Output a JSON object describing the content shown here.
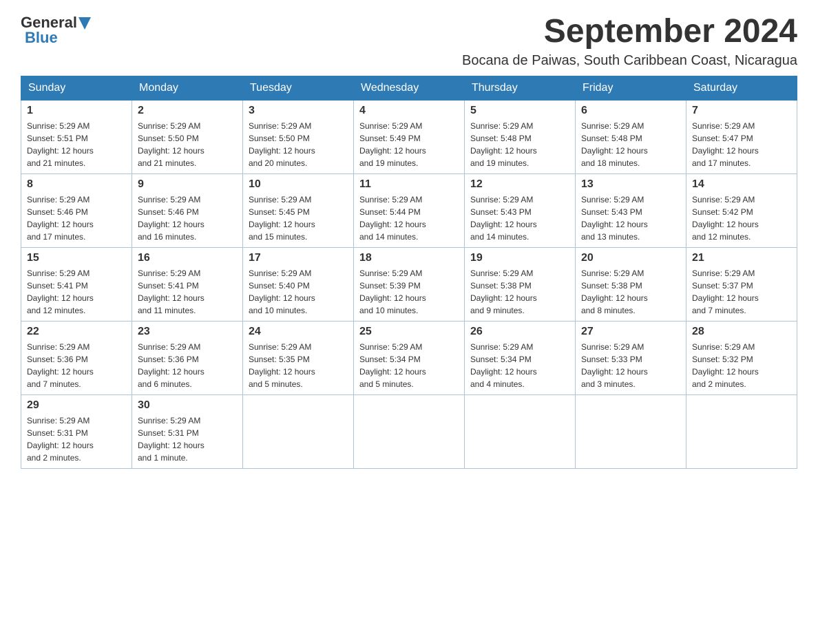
{
  "logo": {
    "general": "General",
    "blue": "Blue"
  },
  "header": {
    "title": "September 2024",
    "subtitle": "Bocana de Paiwas, South Caribbean Coast, Nicaragua"
  },
  "weekdays": [
    "Sunday",
    "Monday",
    "Tuesday",
    "Wednesday",
    "Thursday",
    "Friday",
    "Saturday"
  ],
  "weeks": [
    [
      {
        "day": "1",
        "sunrise": "5:29 AM",
        "sunset": "5:51 PM",
        "daylight": "12 hours and 21 minutes."
      },
      {
        "day": "2",
        "sunrise": "5:29 AM",
        "sunset": "5:50 PM",
        "daylight": "12 hours and 21 minutes."
      },
      {
        "day": "3",
        "sunrise": "5:29 AM",
        "sunset": "5:50 PM",
        "daylight": "12 hours and 20 minutes."
      },
      {
        "day": "4",
        "sunrise": "5:29 AM",
        "sunset": "5:49 PM",
        "daylight": "12 hours and 19 minutes."
      },
      {
        "day": "5",
        "sunrise": "5:29 AM",
        "sunset": "5:48 PM",
        "daylight": "12 hours and 19 minutes."
      },
      {
        "day": "6",
        "sunrise": "5:29 AM",
        "sunset": "5:48 PM",
        "daylight": "12 hours and 18 minutes."
      },
      {
        "day": "7",
        "sunrise": "5:29 AM",
        "sunset": "5:47 PM",
        "daylight": "12 hours and 17 minutes."
      }
    ],
    [
      {
        "day": "8",
        "sunrise": "5:29 AM",
        "sunset": "5:46 PM",
        "daylight": "12 hours and 17 minutes."
      },
      {
        "day": "9",
        "sunrise": "5:29 AM",
        "sunset": "5:46 PM",
        "daylight": "12 hours and 16 minutes."
      },
      {
        "day": "10",
        "sunrise": "5:29 AM",
        "sunset": "5:45 PM",
        "daylight": "12 hours and 15 minutes."
      },
      {
        "day": "11",
        "sunrise": "5:29 AM",
        "sunset": "5:44 PM",
        "daylight": "12 hours and 14 minutes."
      },
      {
        "day": "12",
        "sunrise": "5:29 AM",
        "sunset": "5:43 PM",
        "daylight": "12 hours and 14 minutes."
      },
      {
        "day": "13",
        "sunrise": "5:29 AM",
        "sunset": "5:43 PM",
        "daylight": "12 hours and 13 minutes."
      },
      {
        "day": "14",
        "sunrise": "5:29 AM",
        "sunset": "5:42 PM",
        "daylight": "12 hours and 12 minutes."
      }
    ],
    [
      {
        "day": "15",
        "sunrise": "5:29 AM",
        "sunset": "5:41 PM",
        "daylight": "12 hours and 12 minutes."
      },
      {
        "day": "16",
        "sunrise": "5:29 AM",
        "sunset": "5:41 PM",
        "daylight": "12 hours and 11 minutes."
      },
      {
        "day": "17",
        "sunrise": "5:29 AM",
        "sunset": "5:40 PM",
        "daylight": "12 hours and 10 minutes."
      },
      {
        "day": "18",
        "sunrise": "5:29 AM",
        "sunset": "5:39 PM",
        "daylight": "12 hours and 10 minutes."
      },
      {
        "day": "19",
        "sunrise": "5:29 AM",
        "sunset": "5:38 PM",
        "daylight": "12 hours and 9 minutes."
      },
      {
        "day": "20",
        "sunrise": "5:29 AM",
        "sunset": "5:38 PM",
        "daylight": "12 hours and 8 minutes."
      },
      {
        "day": "21",
        "sunrise": "5:29 AM",
        "sunset": "5:37 PM",
        "daylight": "12 hours and 7 minutes."
      }
    ],
    [
      {
        "day": "22",
        "sunrise": "5:29 AM",
        "sunset": "5:36 PM",
        "daylight": "12 hours and 7 minutes."
      },
      {
        "day": "23",
        "sunrise": "5:29 AM",
        "sunset": "5:36 PM",
        "daylight": "12 hours and 6 minutes."
      },
      {
        "day": "24",
        "sunrise": "5:29 AM",
        "sunset": "5:35 PM",
        "daylight": "12 hours and 5 minutes."
      },
      {
        "day": "25",
        "sunrise": "5:29 AM",
        "sunset": "5:34 PM",
        "daylight": "12 hours and 5 minutes."
      },
      {
        "day": "26",
        "sunrise": "5:29 AM",
        "sunset": "5:34 PM",
        "daylight": "12 hours and 4 minutes."
      },
      {
        "day": "27",
        "sunrise": "5:29 AM",
        "sunset": "5:33 PM",
        "daylight": "12 hours and 3 minutes."
      },
      {
        "day": "28",
        "sunrise": "5:29 AM",
        "sunset": "5:32 PM",
        "daylight": "12 hours and 2 minutes."
      }
    ],
    [
      {
        "day": "29",
        "sunrise": "5:29 AM",
        "sunset": "5:31 PM",
        "daylight": "12 hours and 2 minutes."
      },
      {
        "day": "30",
        "sunrise": "5:29 AM",
        "sunset": "5:31 PM",
        "daylight": "12 hours and 1 minute."
      },
      null,
      null,
      null,
      null,
      null
    ]
  ],
  "labels": {
    "sunrise": "Sunrise:",
    "sunset": "Sunset:",
    "daylight": "Daylight:"
  }
}
